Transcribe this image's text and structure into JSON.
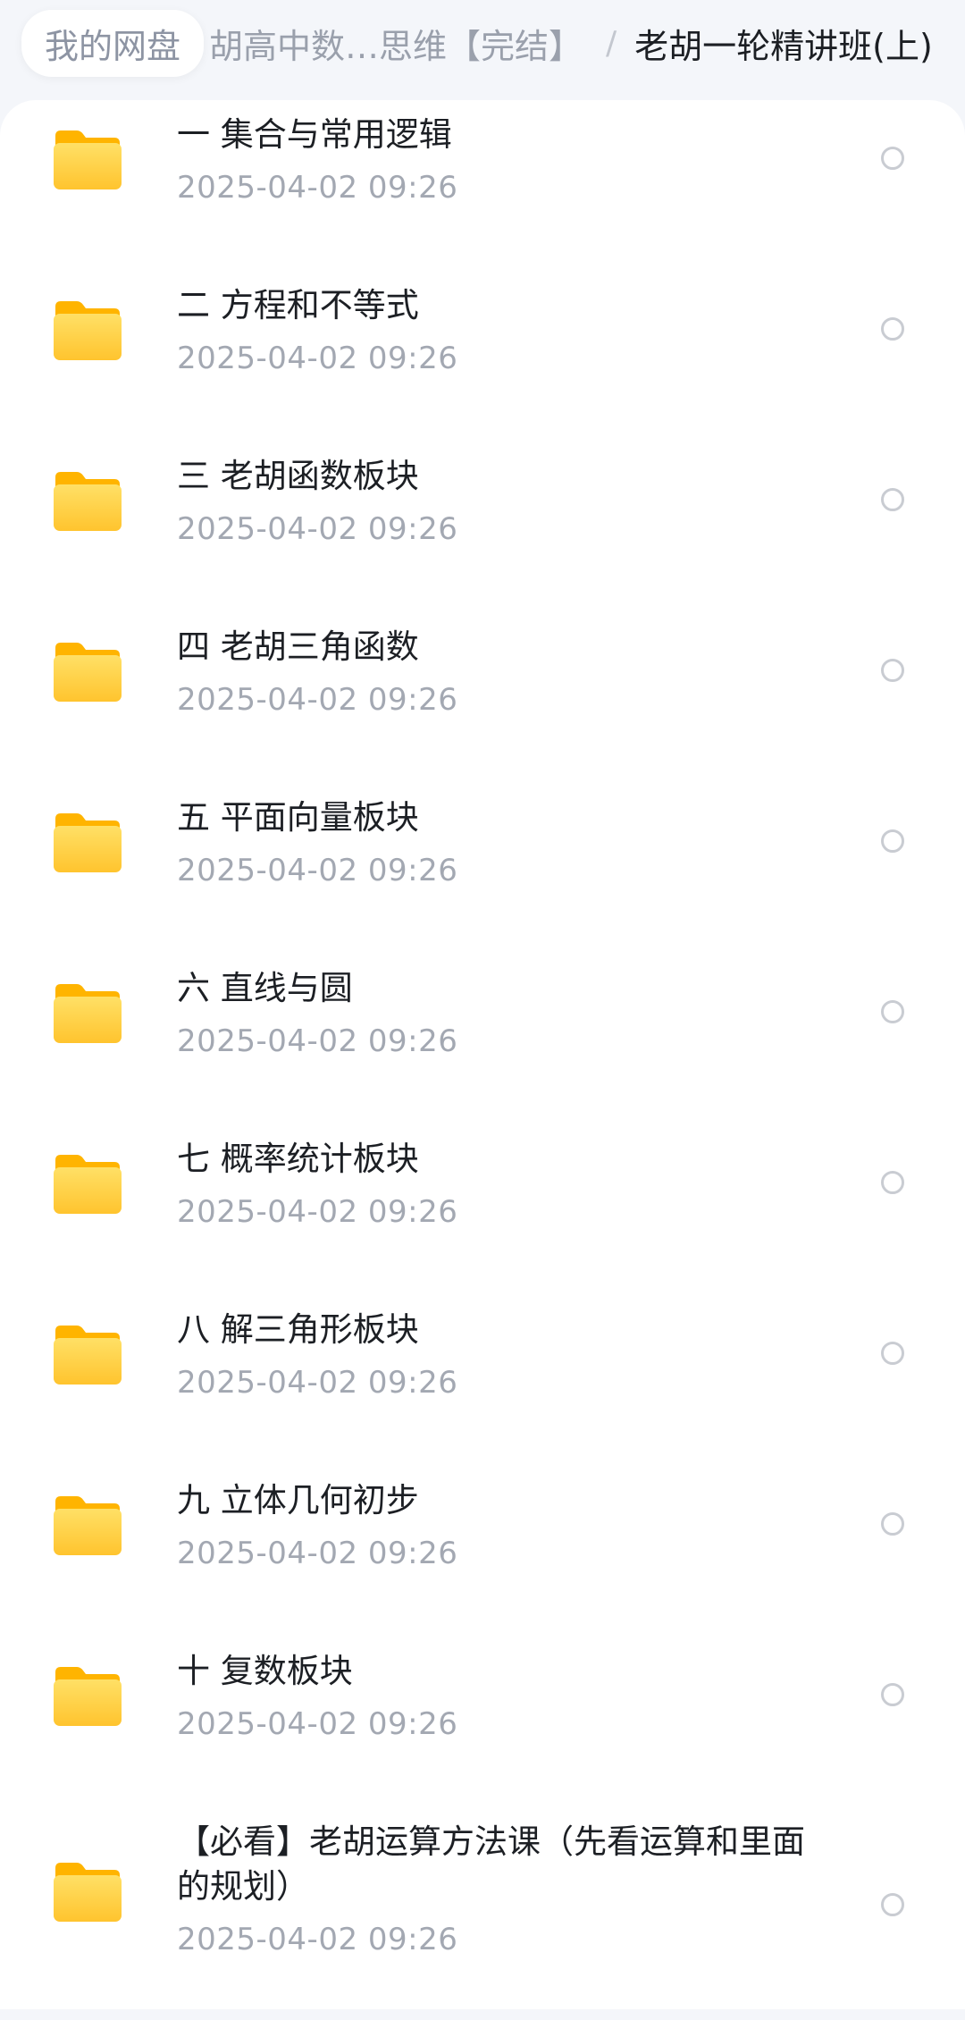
{
  "breadcrumb": {
    "root": "我的网盘",
    "middle": "胡高中数…思维【完结】",
    "separator": "/",
    "current": "老胡一轮精讲班(上)"
  },
  "files": [
    {
      "name": "一 集合与常用逻辑",
      "date": "2025-04-02  09:26"
    },
    {
      "name": "二 方程和不等式",
      "date": "2025-04-02  09:26"
    },
    {
      "name": "三 老胡函数板块",
      "date": "2025-04-02  09:26"
    },
    {
      "name": "四 老胡三角函数",
      "date": "2025-04-02  09:26"
    },
    {
      "name": "五 平面向量板块",
      "date": "2025-04-02  09:26"
    },
    {
      "name": "六 直线与圆",
      "date": "2025-04-02  09:26"
    },
    {
      "name": "七 概率统计板块",
      "date": "2025-04-02  09:26"
    },
    {
      "name": "八 解三角形板块",
      "date": "2025-04-02  09:26"
    },
    {
      "name": "九 立体几何初步",
      "date": "2025-04-02  09:26"
    },
    {
      "name": "十 复数板块",
      "date": "2025-04-02  09:26"
    },
    {
      "name": "【必看】老胡运算方法课（先看运算和里面的规划）",
      "date": "2025-04-02  09:26"
    }
  ],
  "colors": {
    "folder_top": "#ffe066",
    "folder_bottom": "#ffc933",
    "folder_tab": "#ffb700",
    "text_primary": "#1c1f24",
    "text_secondary": "#a3a8b2"
  },
  "icons": {
    "folder": "folder-icon",
    "select": "select-radio-icon"
  }
}
